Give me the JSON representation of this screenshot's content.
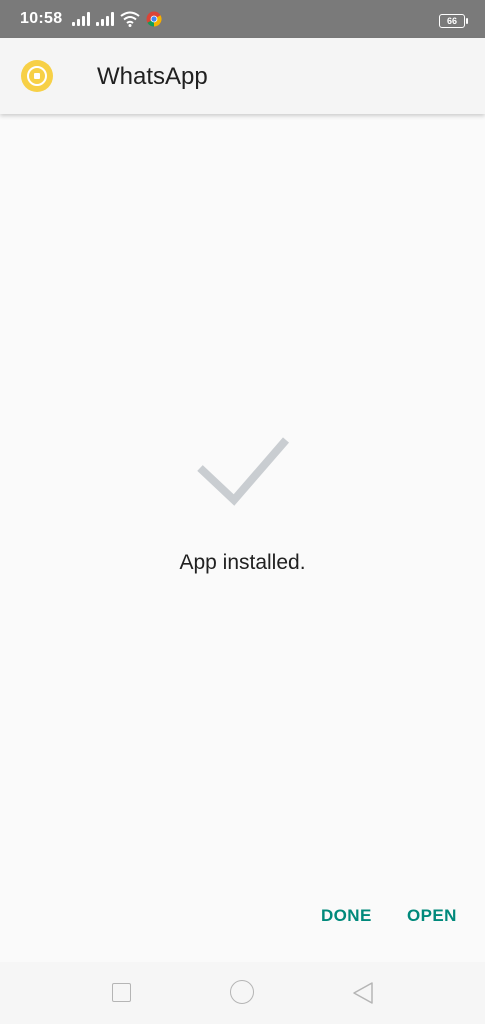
{
  "status_bar": {
    "time": "10:58",
    "battery_level": "66"
  },
  "app_bar": {
    "title": "WhatsApp"
  },
  "main": {
    "message": "App installed."
  },
  "actions": {
    "done_label": "DONE",
    "open_label": "OPEN"
  },
  "colors": {
    "accent": "#00897b",
    "check": "#c9cdd1",
    "logo": "#f7d046"
  }
}
